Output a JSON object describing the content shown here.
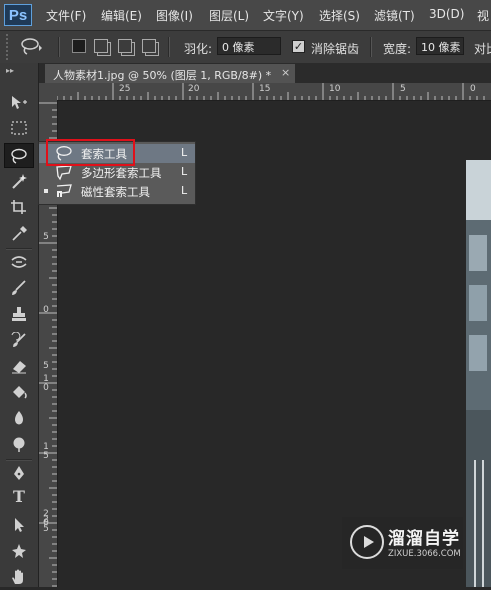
{
  "app": {
    "logo": "Ps"
  },
  "menubar": {
    "items": [
      {
        "label": "文件(F)"
      },
      {
        "label": "编辑(E)"
      },
      {
        "label": "图像(I)"
      },
      {
        "label": "图层(L)"
      },
      {
        "label": "文字(Y)"
      },
      {
        "label": "选择(S)"
      },
      {
        "label": "滤镜(T)"
      },
      {
        "label": "3D(D)"
      },
      {
        "label": "视"
      }
    ]
  },
  "options_bar": {
    "feather_label": "羽化:",
    "feather_value": "0 像素",
    "antialias_label": "消除锯齿",
    "antialias_checked": true,
    "width_label": "宽度:",
    "width_value": "10 像素",
    "contrast_label": "对比"
  },
  "document": {
    "tab_title": "人物素材1.jpg @ 50% (图层 1, RGB/8#) *",
    "close_glyph": "×"
  },
  "rulers": {
    "top_labels": [
      "25",
      "20",
      "15",
      "10",
      "5",
      "0"
    ],
    "left_labels": [
      "5",
      "0",
      "5",
      "1\n0",
      "1\n5",
      "2\n0",
      "2\n5"
    ]
  },
  "tools": [
    {
      "icon": "move-tool-icon"
    },
    {
      "icon": "marquee-tool-icon"
    },
    {
      "icon": "lasso-tool-icon",
      "active": true
    },
    {
      "icon": "magic-wand-icon"
    },
    {
      "icon": "crop-tool-icon"
    },
    {
      "icon": "eyedropper-icon"
    },
    {
      "icon": "healing-brush-icon"
    },
    {
      "icon": "brush-tool-icon"
    },
    {
      "icon": "clone-stamp-icon"
    },
    {
      "icon": "history-brush-icon"
    },
    {
      "icon": "eraser-icon"
    },
    {
      "icon": "paint-bucket-icon"
    },
    {
      "icon": "blur-tool-icon"
    },
    {
      "icon": "dodge-tool-icon"
    },
    {
      "icon": "pen-tool-icon"
    },
    {
      "icon": "type-tool-icon"
    },
    {
      "icon": "path-selection-icon"
    },
    {
      "icon": "shape-tool-icon"
    },
    {
      "icon": "hand-tool-icon"
    }
  ],
  "flyout": {
    "items": [
      {
        "label": "套索工具",
        "shortcut": "L",
        "selected": true
      },
      {
        "label": "多边形套索工具",
        "shortcut": "L",
        "selected": false
      },
      {
        "label": "磁性套索工具",
        "shortcut": "L",
        "selected": false
      }
    ]
  },
  "watermark": {
    "title": "溜溜自学",
    "url": "ZIXUE.3066.COM"
  },
  "colors": {
    "highlight": "#e0101a",
    "menubar": "#484848",
    "canvas": "#282828"
  }
}
